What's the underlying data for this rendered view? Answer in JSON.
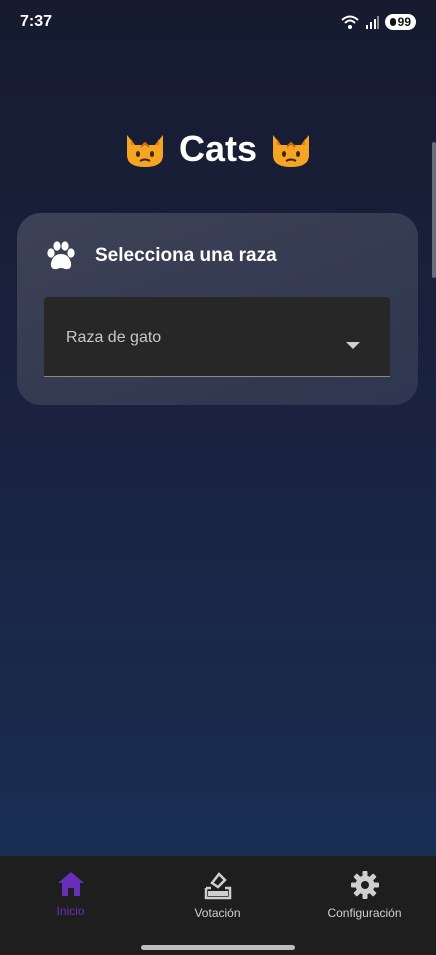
{
  "status_bar": {
    "time": "7:37",
    "battery": "99"
  },
  "app": {
    "title": "Cats"
  },
  "card": {
    "title": "Selecciona una raza",
    "dropdown": {
      "label": "Raza de gato"
    }
  },
  "bottom_nav": {
    "items": [
      {
        "label": "Inicio",
        "icon": "home-icon",
        "active": true
      },
      {
        "label": "Votación",
        "icon": "vote-icon",
        "active": false
      },
      {
        "label": "Configuración",
        "icon": "gear-icon",
        "active": false
      }
    ]
  },
  "colors": {
    "accent": "#6a2fb8",
    "card": "#3a3f55",
    "nav_background": "#1e1e1e"
  }
}
